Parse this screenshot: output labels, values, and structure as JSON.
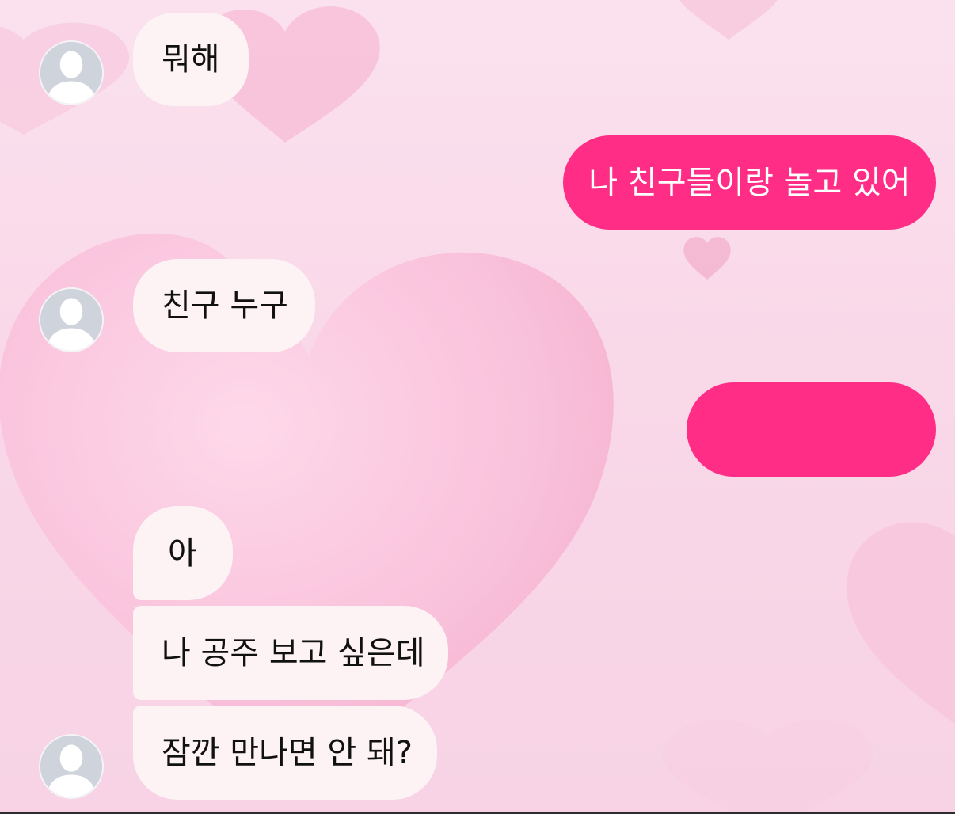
{
  "colors": {
    "background": "#fbe1ee",
    "incoming_bubble": "#fdf2f4",
    "outgoing_bubble": "#ff2d86",
    "incoming_text": "#111111",
    "outgoing_text": "#ffffff",
    "avatar_bg": "#cfd3dc"
  },
  "messages": [
    {
      "sender": "other",
      "text": "뭐해"
    },
    {
      "sender": "me",
      "text": "나 친구들이랑 놀고 있어"
    },
    {
      "sender": "other",
      "text": "친구 누구"
    },
    {
      "sender": "me",
      "text": ""
    },
    {
      "sender": "other",
      "text": "아"
    },
    {
      "sender": "other",
      "text": "나 공주 보고 싶은데"
    },
    {
      "sender": "other",
      "text": "잠깐 만나면 안 돼?"
    }
  ],
  "icons": {
    "avatar": "default-user-silhouette-icon",
    "background": "heart-pattern"
  }
}
